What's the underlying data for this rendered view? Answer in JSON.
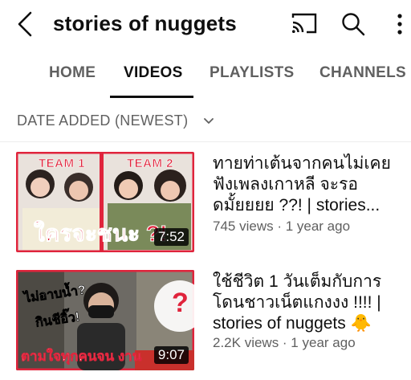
{
  "header": {
    "channel_title": "stories of nuggets",
    "back_icon": "back-arrow-icon",
    "cast_icon": "cast-icon",
    "search_icon": "search-icon",
    "more_icon": "more-vert-icon"
  },
  "tabs": [
    {
      "label": "HOME",
      "active": false
    },
    {
      "label": "VIDEOS",
      "active": true
    },
    {
      "label": "PLAYLISTS",
      "active": false
    },
    {
      "label": "CHANNELS",
      "active": false
    }
  ],
  "sort": {
    "label": "DATE ADDED (NEWEST)"
  },
  "videos": [
    {
      "title": "ทายท่าเต้นจากคนไม่เคยฟังเพลงเกาหลี จะรอดมั้ยยยย ??! | stories...",
      "meta": "745 views · 1 year ago",
      "duration": "7:52",
      "thumb_text": {
        "team1": "TEAM 1",
        "team2": "TEAM 2",
        "caption": "ใครจะชนะ ?!"
      }
    },
    {
      "title": "ใช้ชีวิต 1 วันเต็มกับการโดนชาวเน็ตแกงงง !!!! | stories of nuggets 🐥",
      "meta": "2.2K views · 1 year ago",
      "duration": "9:07",
      "thumb_text": {
        "q1": "ไม่อาบน้ำ?",
        "q2": "กินชีอิ๊ว!",
        "caption": "ตามใจทุกคนจน งาน",
        "mark": "?"
      }
    }
  ],
  "colors": {
    "accent_red": "#e0243c",
    "text_primary": "#0f0f0f",
    "text_secondary": "#606060"
  }
}
